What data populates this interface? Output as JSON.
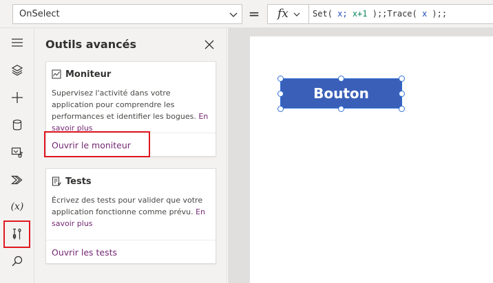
{
  "formula_bar": {
    "property": "OnSelect",
    "equals": "=",
    "fx": "fx",
    "tokens": {
      "t1": "Set(",
      "t2": " x;",
      "t3": " x+1",
      "t4": " );;Trace(",
      "t5": " x",
      "t6": " );;"
    }
  },
  "rail": {
    "variables_label": "(x)"
  },
  "pane": {
    "title": "Outils avancés",
    "monitor": {
      "title": "Moniteur",
      "description": "Supervisez l'activité dans votre application pour comprendre les performances et identifier les bogues.",
      "learn_more": "En savoir plus",
      "action": "Ouvrir le moniteur"
    },
    "tests": {
      "title": "Tests",
      "description": "Écrivez des tests pour valider que votre application fonctionne comme prévu.",
      "learn_more": "En savoir plus",
      "action": "Ouvrir les tests"
    }
  },
  "canvas": {
    "button_label": "Bouton"
  },
  "colors": {
    "accent": "#742774",
    "highlight": "#e0161e",
    "app_button": "#3a5fb8",
    "selection": "#2f6fd6"
  }
}
